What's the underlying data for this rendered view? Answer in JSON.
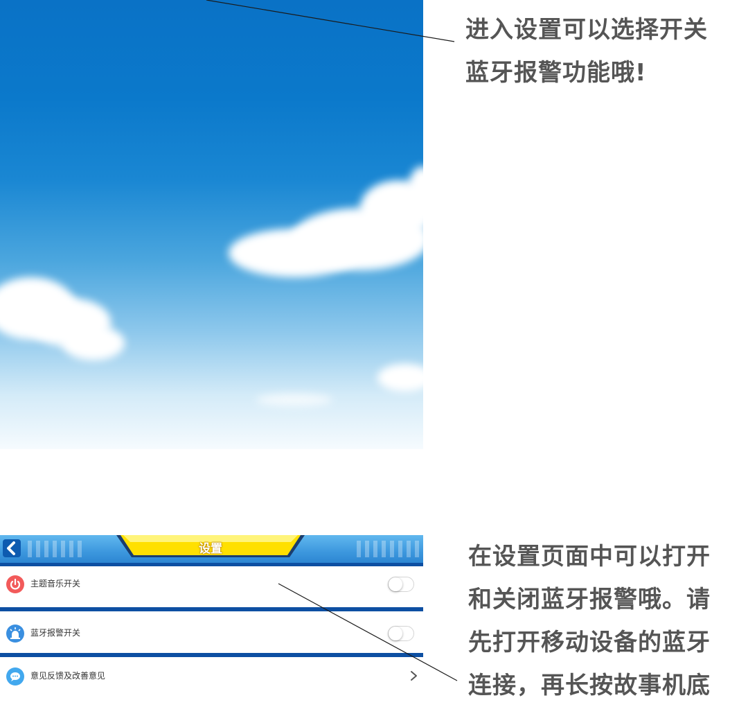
{
  "captions": {
    "top": [
      "进入设置可以选择开关",
      "蓝牙报警功能哦!"
    ],
    "bottom": [
      "在设置页面中可以打开",
      "和关闭蓝牙报警哦。请",
      "先打开移动设备的蓝牙",
      "连接，再长按故事机底"
    ]
  },
  "settings": {
    "title": "设置",
    "items": [
      {
        "label": "主题音乐开关",
        "icon": "power-icon",
        "control": "toggle",
        "state": "off"
      },
      {
        "label": "蓝牙报警开关",
        "icon": "alarm-light-icon",
        "control": "toggle",
        "state": "off"
      },
      {
        "label": "意见反馈及改善意见",
        "icon": "chat-bubble-icon",
        "control": "chevron"
      }
    ]
  },
  "colors": {
    "caption_text": "#555555",
    "header_blue": "#3d98de",
    "divider_blue": "#0d4fa2",
    "title_tab_yellow": "#ffe000",
    "power_icon": "#f25a5a",
    "alarm_icon": "#3a8fe0",
    "chat_icon": "#42a8ee"
  }
}
